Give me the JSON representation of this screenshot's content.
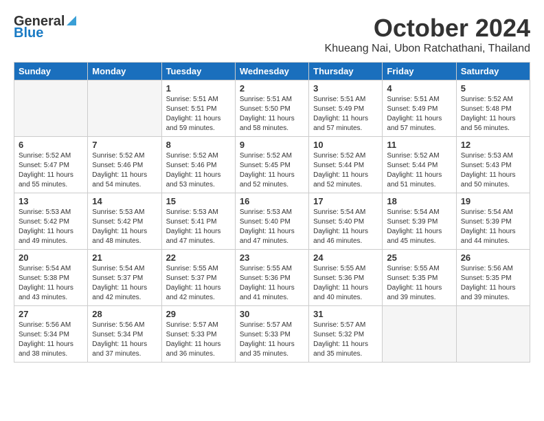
{
  "header": {
    "logo_general": "General",
    "logo_blue": "Blue",
    "month": "October 2024",
    "location": "Khueang Nai, Ubon Ratchathani, Thailand"
  },
  "days_of_week": [
    "Sunday",
    "Monday",
    "Tuesday",
    "Wednesday",
    "Thursday",
    "Friday",
    "Saturday"
  ],
  "weeks": [
    [
      {
        "num": "",
        "empty": true
      },
      {
        "num": "",
        "empty": true
      },
      {
        "num": "1",
        "sunrise": "5:51 AM",
        "sunset": "5:51 PM",
        "daylight": "11 hours and 59 minutes."
      },
      {
        "num": "2",
        "sunrise": "5:51 AM",
        "sunset": "5:50 PM",
        "daylight": "11 hours and 58 minutes."
      },
      {
        "num": "3",
        "sunrise": "5:51 AM",
        "sunset": "5:49 PM",
        "daylight": "11 hours and 57 minutes."
      },
      {
        "num": "4",
        "sunrise": "5:51 AM",
        "sunset": "5:49 PM",
        "daylight": "11 hours and 57 minutes."
      },
      {
        "num": "5",
        "sunrise": "5:52 AM",
        "sunset": "5:48 PM",
        "daylight": "11 hours and 56 minutes."
      }
    ],
    [
      {
        "num": "6",
        "sunrise": "5:52 AM",
        "sunset": "5:47 PM",
        "daylight": "11 hours and 55 minutes."
      },
      {
        "num": "7",
        "sunrise": "5:52 AM",
        "sunset": "5:46 PM",
        "daylight": "11 hours and 54 minutes."
      },
      {
        "num": "8",
        "sunrise": "5:52 AM",
        "sunset": "5:46 PM",
        "daylight": "11 hours and 53 minutes."
      },
      {
        "num": "9",
        "sunrise": "5:52 AM",
        "sunset": "5:45 PM",
        "daylight": "11 hours and 52 minutes."
      },
      {
        "num": "10",
        "sunrise": "5:52 AM",
        "sunset": "5:44 PM",
        "daylight": "11 hours and 52 minutes."
      },
      {
        "num": "11",
        "sunrise": "5:52 AM",
        "sunset": "5:44 PM",
        "daylight": "11 hours and 51 minutes."
      },
      {
        "num": "12",
        "sunrise": "5:53 AM",
        "sunset": "5:43 PM",
        "daylight": "11 hours and 50 minutes."
      }
    ],
    [
      {
        "num": "13",
        "sunrise": "5:53 AM",
        "sunset": "5:42 PM",
        "daylight": "11 hours and 49 minutes."
      },
      {
        "num": "14",
        "sunrise": "5:53 AM",
        "sunset": "5:42 PM",
        "daylight": "11 hours and 48 minutes."
      },
      {
        "num": "15",
        "sunrise": "5:53 AM",
        "sunset": "5:41 PM",
        "daylight": "11 hours and 47 minutes."
      },
      {
        "num": "16",
        "sunrise": "5:53 AM",
        "sunset": "5:40 PM",
        "daylight": "11 hours and 47 minutes."
      },
      {
        "num": "17",
        "sunrise": "5:54 AM",
        "sunset": "5:40 PM",
        "daylight": "11 hours and 46 minutes."
      },
      {
        "num": "18",
        "sunrise": "5:54 AM",
        "sunset": "5:39 PM",
        "daylight": "11 hours and 45 minutes."
      },
      {
        "num": "19",
        "sunrise": "5:54 AM",
        "sunset": "5:39 PM",
        "daylight": "11 hours and 44 minutes."
      }
    ],
    [
      {
        "num": "20",
        "sunrise": "5:54 AM",
        "sunset": "5:38 PM",
        "daylight": "11 hours and 43 minutes."
      },
      {
        "num": "21",
        "sunrise": "5:54 AM",
        "sunset": "5:37 PM",
        "daylight": "11 hours and 42 minutes."
      },
      {
        "num": "22",
        "sunrise": "5:55 AM",
        "sunset": "5:37 PM",
        "daylight": "11 hours and 42 minutes."
      },
      {
        "num": "23",
        "sunrise": "5:55 AM",
        "sunset": "5:36 PM",
        "daylight": "11 hours and 41 minutes."
      },
      {
        "num": "24",
        "sunrise": "5:55 AM",
        "sunset": "5:36 PM",
        "daylight": "11 hours and 40 minutes."
      },
      {
        "num": "25",
        "sunrise": "5:55 AM",
        "sunset": "5:35 PM",
        "daylight": "11 hours and 39 minutes."
      },
      {
        "num": "26",
        "sunrise": "5:56 AM",
        "sunset": "5:35 PM",
        "daylight": "11 hours and 39 minutes."
      }
    ],
    [
      {
        "num": "27",
        "sunrise": "5:56 AM",
        "sunset": "5:34 PM",
        "daylight": "11 hours and 38 minutes."
      },
      {
        "num": "28",
        "sunrise": "5:56 AM",
        "sunset": "5:34 PM",
        "daylight": "11 hours and 37 minutes."
      },
      {
        "num": "29",
        "sunrise": "5:57 AM",
        "sunset": "5:33 PM",
        "daylight": "11 hours and 36 minutes."
      },
      {
        "num": "30",
        "sunrise": "5:57 AM",
        "sunset": "5:33 PM",
        "daylight": "11 hours and 35 minutes."
      },
      {
        "num": "31",
        "sunrise": "5:57 AM",
        "sunset": "5:32 PM",
        "daylight": "11 hours and 35 minutes."
      },
      {
        "num": "",
        "empty": true
      },
      {
        "num": "",
        "empty": true
      }
    ]
  ],
  "labels": {
    "sunrise_prefix": "Sunrise: ",
    "sunset_prefix": "Sunset: ",
    "daylight_prefix": "Daylight: "
  }
}
